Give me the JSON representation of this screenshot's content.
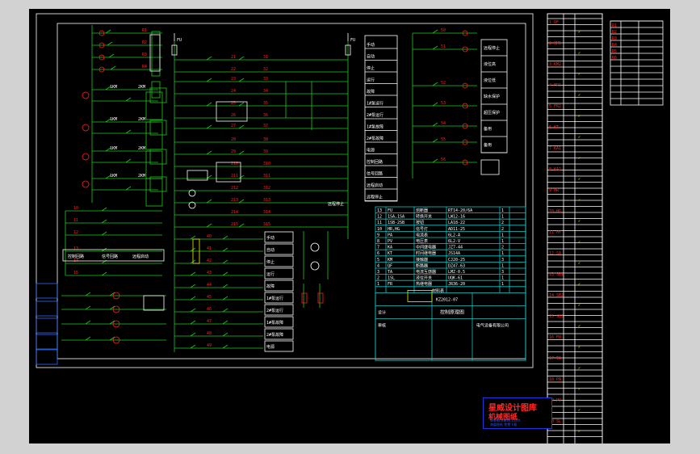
{
  "colors": {
    "workspace": "#d2d2d2",
    "canvas": "#000000",
    "border": "#ffffff",
    "wire": "#1ec81e",
    "node_label": "#ff2020",
    "device_text": "#ffffff",
    "table": "#15c4c4",
    "ledger_text": "#ff2020",
    "highlight": "#f0f000",
    "logo_frame": "#1e35e0"
  },
  "drawing": {
    "sheet_label": "控制原理图",
    "bom_title": "材料表",
    "bom_rows": [
      {
        "no": "13",
        "code": "FU",
        "name": "熔断器",
        "spec": "RT14-20/6A",
        "qty": "1"
      },
      {
        "no": "12",
        "code": "1SA,1SA",
        "name": "转换开关",
        "spec": "LW12-16",
        "qty": "1"
      },
      {
        "no": "11",
        "code": "1SB-2SB",
        "name": "按钮",
        "spec": "LA18-22",
        "qty": "2"
      },
      {
        "no": "10",
        "code": "HR,HG",
        "name": "信号灯",
        "spec": "AD11-25",
        "qty": "2"
      },
      {
        "no": "9",
        "code": "PA",
        "name": "电流表",
        "spec": "6L2-A",
        "qty": "1"
      },
      {
        "no": "8",
        "code": "PV",
        "name": "电压表",
        "spec": "6L2-V",
        "qty": "1"
      },
      {
        "no": "7",
        "code": "KA",
        "name": "中间继电器",
        "spec": "JZ7-44",
        "qty": "2"
      },
      {
        "no": "6",
        "code": "KT",
        "name": "时间继电器",
        "spec": "JS14A",
        "qty": "1"
      },
      {
        "no": "5",
        "code": "KM",
        "name": "接触器",
        "spec": "CJ20-25",
        "qty": "3"
      },
      {
        "no": "4",
        "code": "QF",
        "name": "断路器",
        "spec": "DZ47-63",
        "qty": "1"
      },
      {
        "no": "3",
        "code": "TA",
        "name": "电流互感器",
        "spec": "LMZ-0.5",
        "qty": "3"
      },
      {
        "no": "2",
        "code": "1SL",
        "name": "液位开关",
        "spec": "UQK-61",
        "qty": "1"
      },
      {
        "no": "1",
        "code": "FR",
        "name": "热继电器",
        "spec": "JR36-20",
        "qty": "1"
      }
    ],
    "title_block": {
      "drawing_no": "KZ2012-07",
      "project": "控制原理图",
      "designer": "设计",
      "checker": "审核",
      "company": "电气设备有限公司"
    },
    "right_notes": [
      "手动",
      "自动",
      "停止",
      "运行",
      "故障",
      "1#泵运行",
      "2#泵运行",
      "1#泵故障",
      "2#泵故障",
      "电源",
      "控制回路",
      "信号回路",
      "远程启动",
      "远程停止",
      "液位高",
      "液位低",
      "缺水保护",
      "超压保护",
      "备用",
      "备用"
    ],
    "ledger_rows": [
      "1 QF",
      "2 KM1",
      "3 KM2",
      "4 FR1",
      "5 FR2",
      "6 KT",
      "7 KA1",
      "8 KA2",
      "9 HR",
      "10 HG",
      "11 HY",
      "12 SA",
      "13 SB1",
      "14 SB2",
      "15 SB3",
      "16 FU",
      "17 TA",
      "18 PA",
      "19 PV",
      "20 SL"
    ]
  },
  "watermark": {
    "title": "星威设计图库",
    "subtitle": "机械图纸",
    "url": "www.xwtk.com",
    "tagline": "海量图纸 免费下载"
  }
}
